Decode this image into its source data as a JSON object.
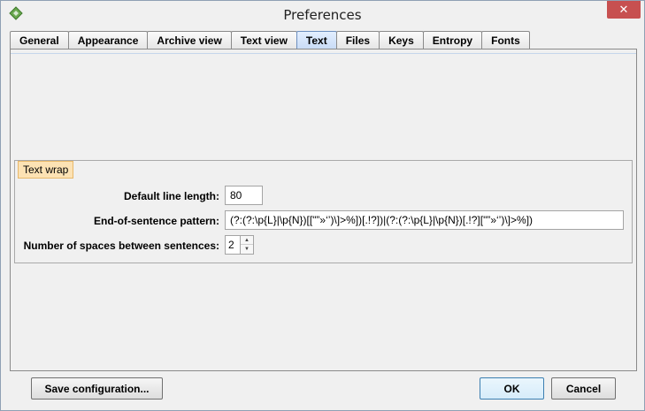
{
  "window": {
    "title": "Preferences",
    "close_label": "✕"
  },
  "tabs": [
    {
      "label": "General"
    },
    {
      "label": "Appearance"
    },
    {
      "label": "Archive view"
    },
    {
      "label": "Text view"
    },
    {
      "label": "Text"
    },
    {
      "label": "Files"
    },
    {
      "label": "Keys"
    },
    {
      "label": "Entropy"
    },
    {
      "label": "Fonts"
    }
  ],
  "active_tab": "Text",
  "text_wrap": {
    "group_title": "Text wrap",
    "default_line_length_label": "Default line length:",
    "default_line_length_value": "80",
    "sentence_pattern_label": "End-of-sentence pattern:",
    "sentence_pattern_value": "(?:(?:\\p{L}|\\p{N})[[\"”»‘’)\\]>%])[.!?])|(?:(?:\\p{L}|\\p{N})[.!?][\"”»‘’)\\]>%])",
    "spaces_label": "Number of spaces between sentences:",
    "spaces_value": "2"
  },
  "buttons": {
    "save_configuration": "Save configuration...",
    "ok": "OK",
    "cancel": "Cancel"
  },
  "icons": {
    "app": "app-icon",
    "close": "close-icon",
    "spinner_up": "spinner-up-icon",
    "spinner_down": "spinner-down-icon"
  },
  "colors": {
    "close_button": "#c75050",
    "active_tab": "#c9dcf6",
    "group_title_bg": "#fce2b4",
    "default_button_border": "#3c7fb1"
  }
}
